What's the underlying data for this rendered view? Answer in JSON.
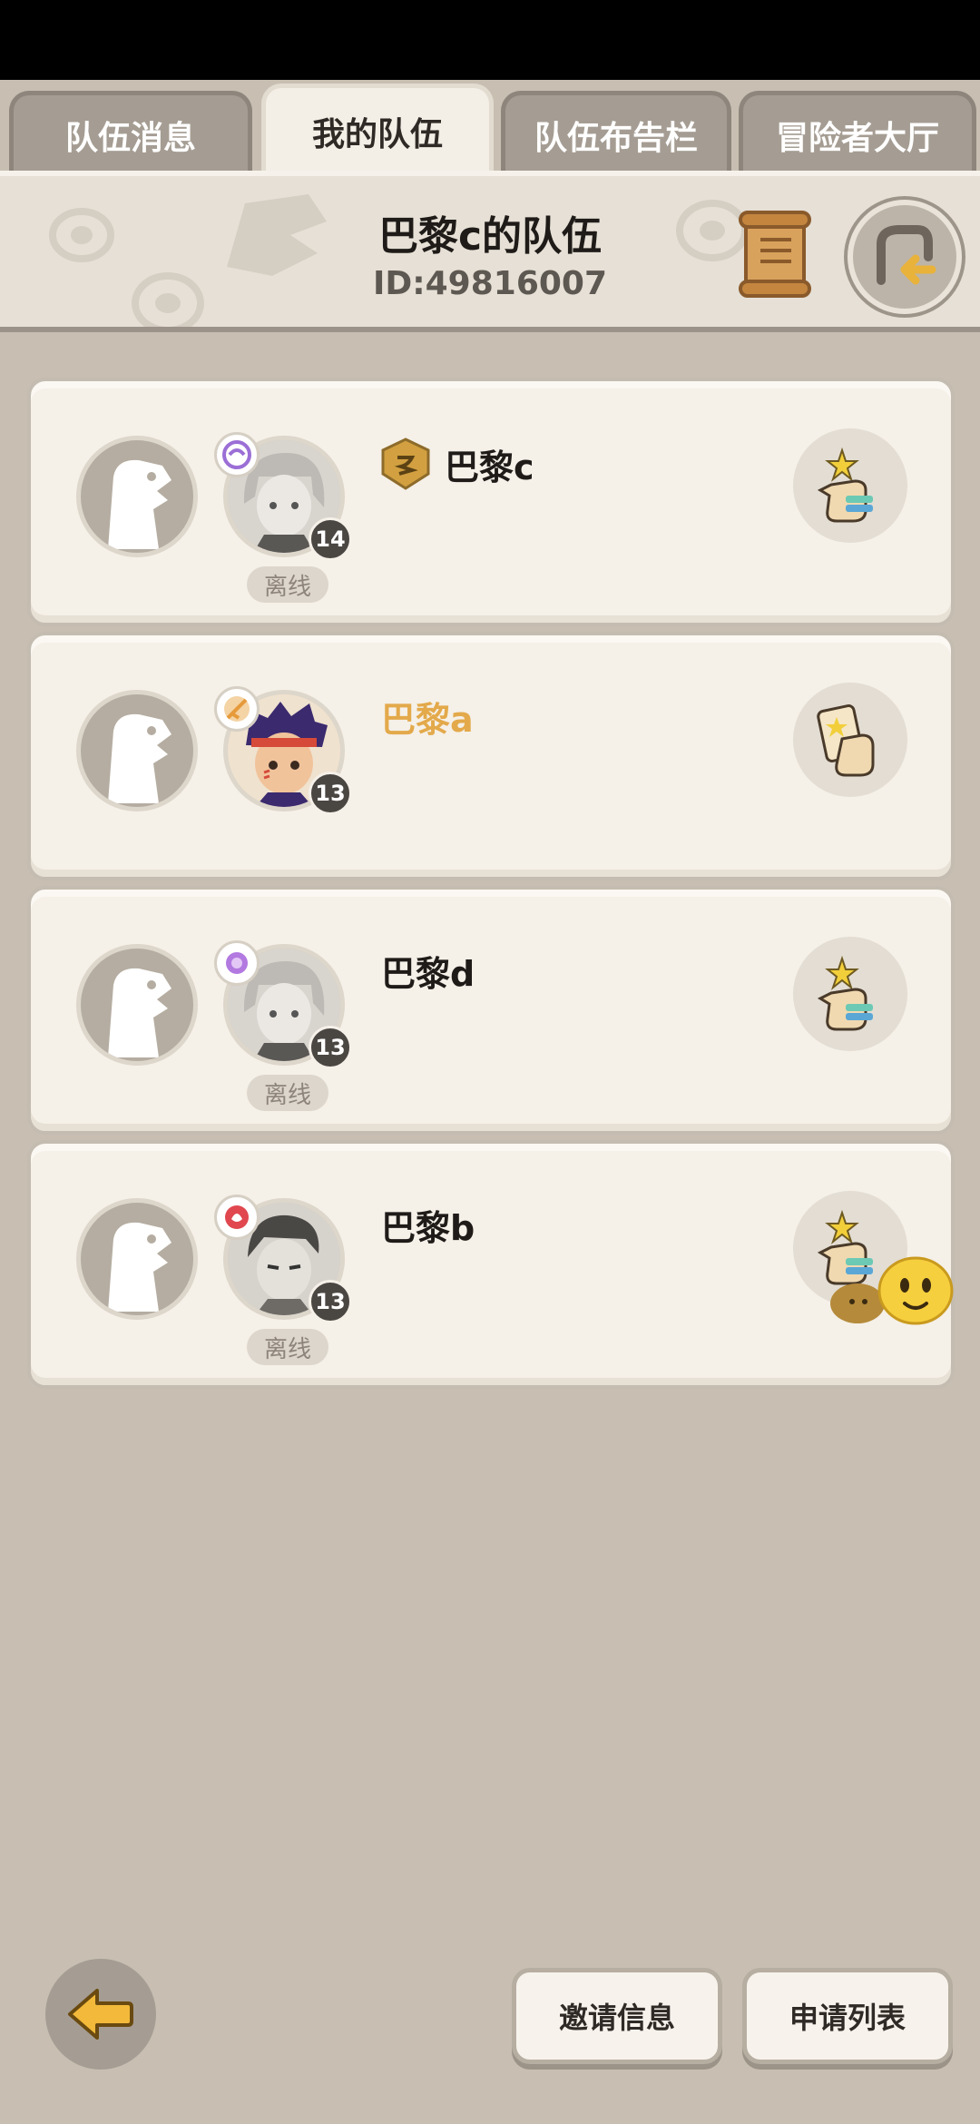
{
  "tabs": [
    {
      "label": "队伍消息",
      "active": false
    },
    {
      "label": "我的队伍",
      "active": true
    },
    {
      "label": "队伍布告栏",
      "active": false
    },
    {
      "label": "冒险者大厅",
      "active": false
    }
  ],
  "team": {
    "name": "巴黎c的队伍",
    "id": "ID:49816007"
  },
  "members": [
    {
      "name": "巴黎c",
      "level": "14",
      "status": "离线",
      "leader": true,
      "is_self": false,
      "class_color": "#9b6fd6",
      "action_icon": "hand-star-icon"
    },
    {
      "name": "巴黎a",
      "level": "13",
      "status": "",
      "leader": false,
      "is_self": true,
      "class_color": "#e69a3a",
      "action_icon": "hand-card-icon"
    },
    {
      "name": "巴黎d",
      "level": "13",
      "status": "离线",
      "leader": false,
      "is_self": false,
      "class_color": "#b279e0",
      "action_icon": "hand-star-icon"
    },
    {
      "name": "巴黎b",
      "level": "13",
      "status": "离线",
      "leader": false,
      "is_self": false,
      "class_color": "#e0474f",
      "action_icon": "hand-star-icon"
    }
  ],
  "bottom": {
    "invite_label": "邀请信息",
    "apply_label": "申请列表"
  },
  "colors": {
    "background": "#c8bfb2",
    "self_name": "#e3a94a",
    "leader_badge": "#d2a040"
  }
}
